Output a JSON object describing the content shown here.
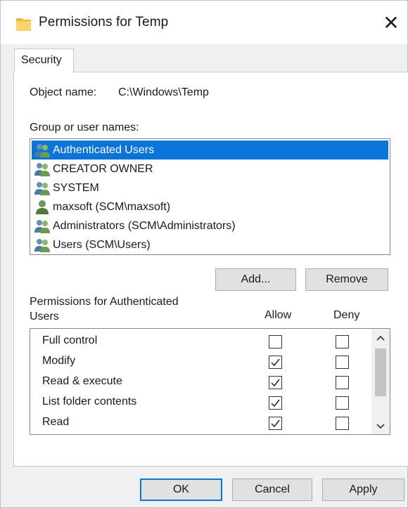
{
  "window": {
    "title": "Permissions for Temp",
    "close_glyph": "✕"
  },
  "tabs": [
    {
      "label": "Security"
    }
  ],
  "object": {
    "label": "Object name:",
    "value": "C:\\Windows\\Temp"
  },
  "group_list": {
    "label": "Group or user names:",
    "selected_index": 0,
    "items": [
      {
        "label": "Authenticated Users",
        "icon": "group-users-icon"
      },
      {
        "label": "CREATOR OWNER",
        "icon": "group-users-icon"
      },
      {
        "label": "SYSTEM",
        "icon": "group-users-icon"
      },
      {
        "label": "maxsoft (SCM\\maxsoft)",
        "icon": "single-user-icon"
      },
      {
        "label": "Administrators (SCM\\Administrators)",
        "icon": "group-users-icon"
      },
      {
        "label": "Users (SCM\\Users)",
        "icon": "group-users-icon"
      }
    ]
  },
  "buttons": {
    "add": "Add...",
    "remove": "Remove",
    "ok": "OK",
    "cancel": "Cancel",
    "apply": "Apply"
  },
  "permissions": {
    "label_line1": "Permissions for Authenticated",
    "label_line2": "Users",
    "allow_header": "Allow",
    "deny_header": "Deny",
    "rows": [
      {
        "name": "Full control",
        "allow": false,
        "deny": false
      },
      {
        "name": "Modify",
        "allow": true,
        "deny": false
      },
      {
        "name": "Read & execute",
        "allow": true,
        "deny": false
      },
      {
        "name": "List folder contents",
        "allow": true,
        "deny": false
      },
      {
        "name": "Read",
        "allow": true,
        "deny": false
      },
      {
        "name": "",
        "allow": false,
        "deny": false
      }
    ]
  }
}
